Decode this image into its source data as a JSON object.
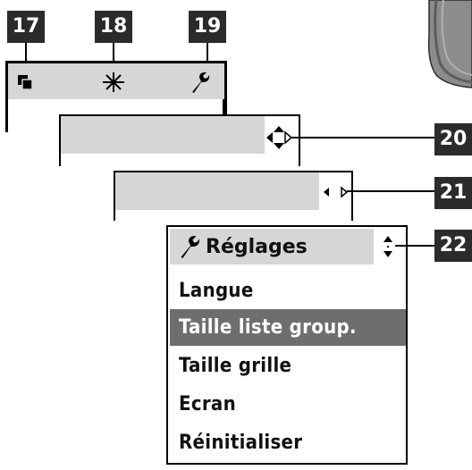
{
  "callouts": {
    "c17": "17",
    "c18": "18",
    "c19": "19",
    "c20": "20",
    "c21": "21",
    "c22": "22"
  },
  "toolbar": {
    "icons": [
      "layers-icon",
      "sparkle-icon",
      "wrench-icon"
    ]
  },
  "menu": {
    "title": "Réglages",
    "title_icon": "wrench-icon",
    "scroll_icon": "up-down-arrows-icon",
    "items": [
      {
        "label": "Langue",
        "selected": false
      },
      {
        "label": "Taille liste group.",
        "selected": true
      },
      {
        "label": "Taille grille",
        "selected": false
      },
      {
        "label": "Ecran",
        "selected": false
      },
      {
        "label": "Réinitialiser",
        "selected": false
      }
    ]
  },
  "colors": {
    "callout_bg": "#2b2b2b",
    "panel_gray": "#d6d6d6",
    "selection_bg": "#6e6e6e",
    "device_gray": "#8c8c8c"
  }
}
